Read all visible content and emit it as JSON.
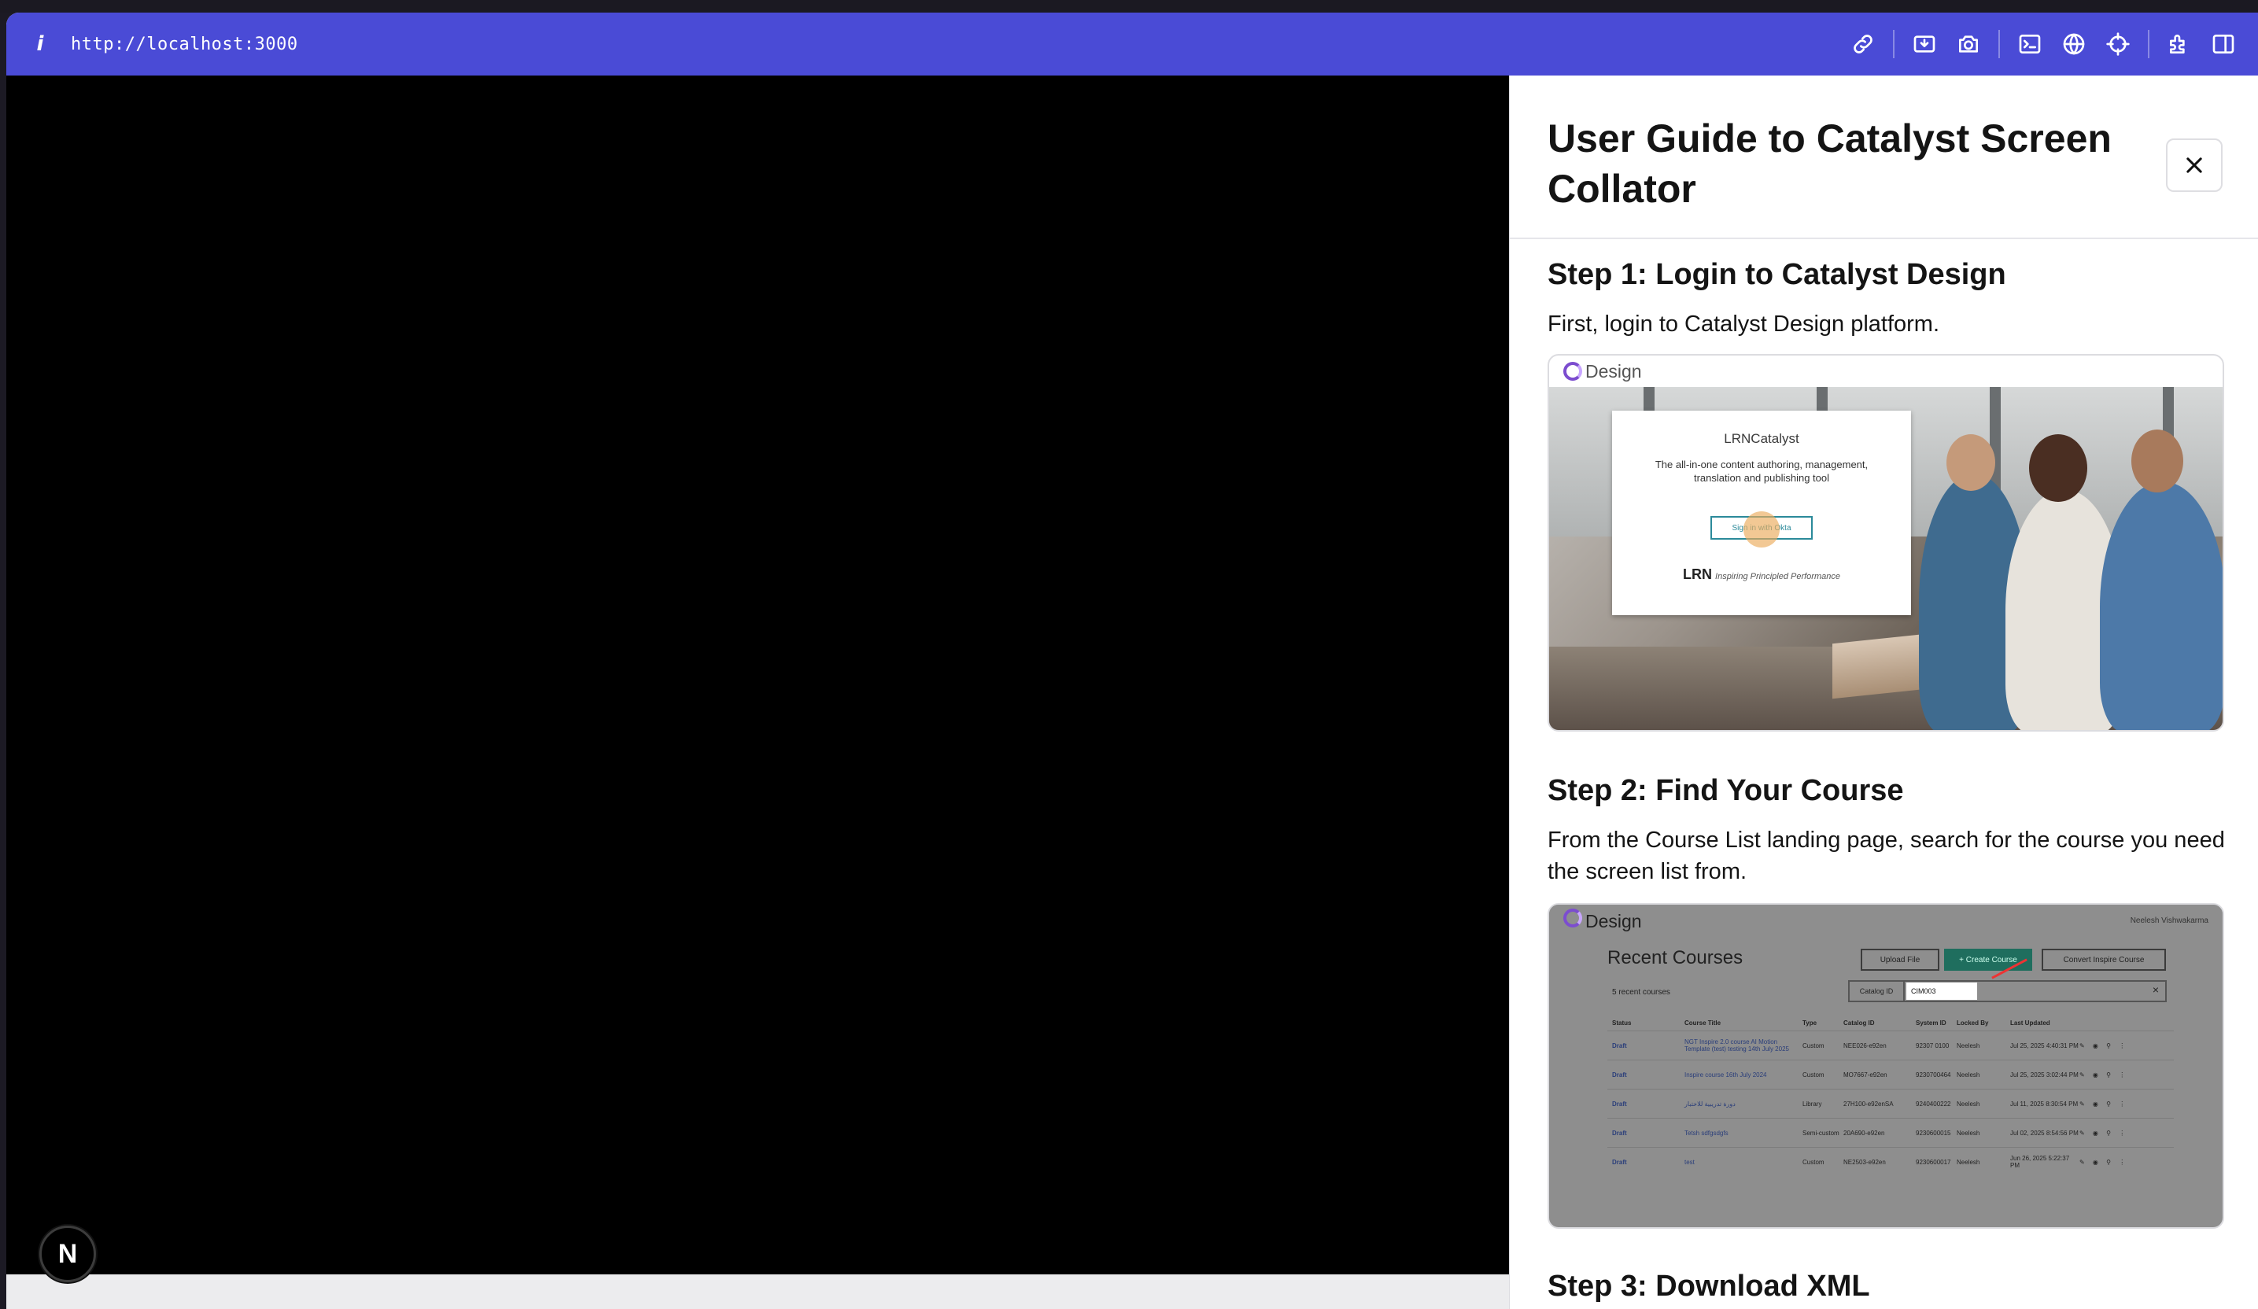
{
  "browser": {
    "url": "http://localhost:3000",
    "toolbar_icons": [
      "link-icon",
      "screenshot-region-icon",
      "camera-icon",
      "terminal-icon",
      "globe-icon",
      "crosshair-icon",
      "extension-icon",
      "split-panel-icon"
    ]
  },
  "viewport": {
    "badge": "N"
  },
  "guide": {
    "title": "User Guide to Catalyst Screen Collator",
    "steps": [
      {
        "title": "Step 1: Login to Catalyst Design",
        "text": "First, login to Catalyst Design platform.",
        "shot": {
          "header": "Design",
          "logo": "LRNCatalyst",
          "tagline": "The all-in-one content authoring, management, translation and publishing tool",
          "button": "Sign in with Okta",
          "footer_brand": "LRN",
          "footer_tagline": "Inspiring Principled Performance"
        }
      },
      {
        "title": "Step 2: Find Your Course",
        "text": "From the Course List landing page, search for the course you need the screen list from.",
        "shot": {
          "header": "Design",
          "user": "Neelesh Vishwakarma",
          "page_title": "Recent Courses",
          "buttons": [
            "Upload File",
            "+ Create Course",
            "Convert Inspire Course"
          ],
          "count": "5 recent courses",
          "filter": "Catalog ID",
          "search_value": "CIM003",
          "columns": [
            "Status",
            "Course Title",
            "Type",
            "Catalog ID",
            "System ID",
            "Locked By",
            "Last Updated",
            ""
          ],
          "rows": [
            [
              "Draft",
              "NGT Inspire 2.0 course AI Motion Template (test) testing 14th July 2025",
              "Custom",
              "NEE026-e92en",
              "92307 0100",
              "Neelesh",
              "Jul 25, 2025 4:40:31 PM",
              "✎ ◉ ⚲ ⋮"
            ],
            [
              "Draft",
              "Inspire course 16th July 2024",
              "Custom",
              "MO7667-e92en",
              "9230700464",
              "Neelesh",
              "Jul 25, 2025 3:02:44 PM",
              "✎ ◉ ⚲ ⋮"
            ],
            [
              "Draft",
              "دورة تدريبية للاختبار",
              "Library",
              "27H100-e92enSA",
              "9240400222",
              "Neelesh",
              "Jul 11, 2025 8:30:54 PM",
              "✎ ◉ ⚲ ⋮"
            ],
            [
              "Draft",
              "Tetsh sdfgsdgfs",
              "Semi-custom",
              "20A690-e92en",
              "9230600015",
              "Neelesh",
              "Jul 02, 2025 8:54:56 PM",
              "✎ ◉ ⚲ ⋮"
            ],
            [
              "Draft",
              "test",
              "Custom",
              "NE2503-e92en",
              "9230600017",
              "Neelesh",
              "Jun 26, 2025 5:22:37 PM",
              "✎ ◉ ⚲ ⋮"
            ]
          ]
        }
      },
      {
        "title": "Step 3: Download XML"
      }
    ]
  }
}
